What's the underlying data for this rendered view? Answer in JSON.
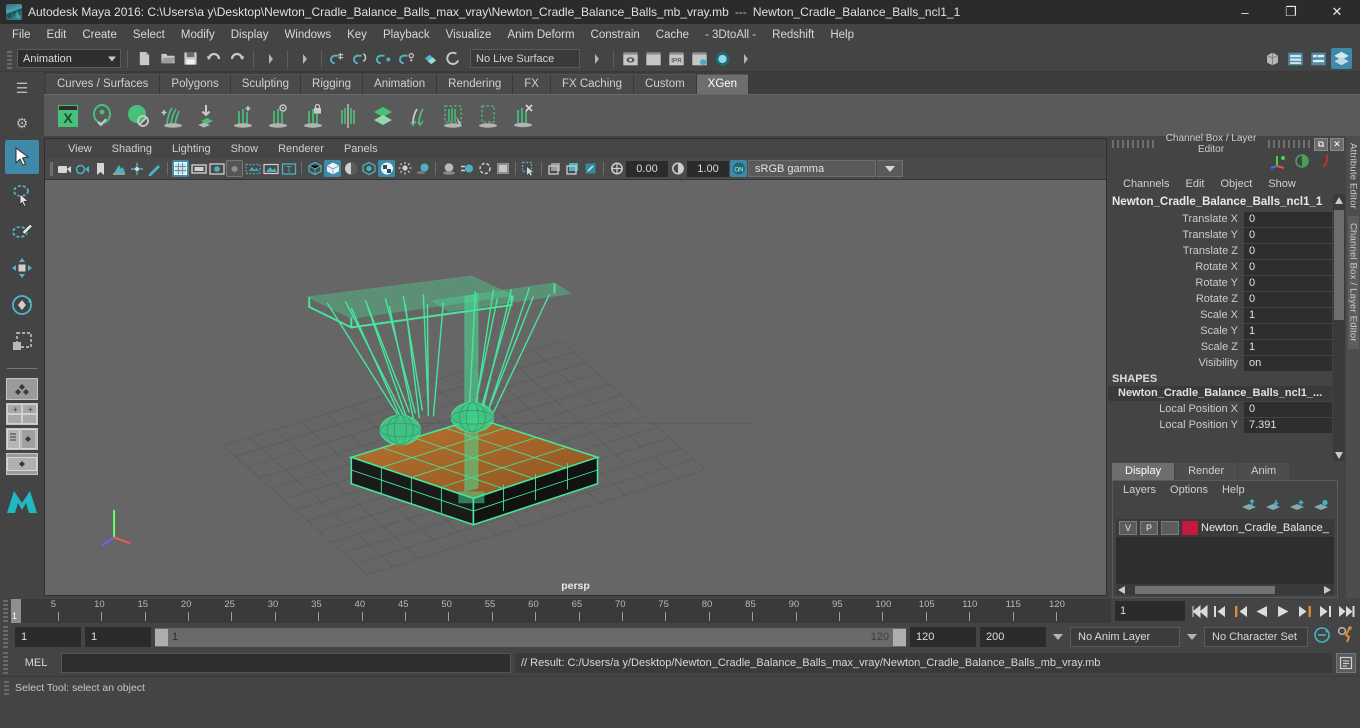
{
  "titlebar": {
    "app_title": "Autodesk Maya 2016: C:\\Users\\a y\\Desktop\\Newton_Cradle_Balance_Balls_max_vray\\Newton_Cradle_Balance_Balls_mb_vray.mb",
    "separator": "---",
    "selected_object": "Newton_Cradle_Balance_Balls_ncl1_1",
    "minimize": "–",
    "maximize": "❐",
    "close": "✕"
  },
  "menubar": {
    "items": [
      "File",
      "Edit",
      "Create",
      "Select",
      "Modify",
      "Display",
      "Windows",
      "Key",
      "Playback",
      "Visualize",
      "Anim Deform",
      "Constrain",
      "Cache",
      "- 3DtoAll -",
      "Redshift",
      "Help"
    ]
  },
  "statusline": {
    "mode": "Animation",
    "live_surface": "No Live Surface"
  },
  "shelf": {
    "tabs": [
      "Curves / Surfaces",
      "Polygons",
      "Sculpting",
      "Rigging",
      "Animation",
      "Rendering",
      "FX",
      "FX Caching",
      "Custom",
      "XGen"
    ],
    "active_tab": "XGen"
  },
  "viewport": {
    "menus": [
      "View",
      "Shading",
      "Lighting",
      "Show",
      "Renderer",
      "Panels"
    ],
    "exposure": "0.00",
    "gamma_value": "1.00",
    "color_toggle": "ON",
    "color_profile": "sRGB gamma",
    "camera_label": "persp",
    "background_color": "#666666",
    "wireframe_color": "#45e79a",
    "base_color": "#b5652f"
  },
  "channelbox": {
    "panel_title": "Channel Box / Layer Editor",
    "menus": [
      "Channels",
      "Edit",
      "Object",
      "Show"
    ],
    "object_name": "Newton_Cradle_Balance_Balls_ncl1_1",
    "transform_rows": [
      {
        "attr": "Translate X",
        "value": "0"
      },
      {
        "attr": "Translate Y",
        "value": "0"
      },
      {
        "attr": "Translate Z",
        "value": "0"
      },
      {
        "attr": "Rotate X",
        "value": "0"
      },
      {
        "attr": "Rotate Y",
        "value": "0"
      },
      {
        "attr": "Rotate Z",
        "value": "0"
      },
      {
        "attr": "Scale X",
        "value": "1"
      },
      {
        "attr": "Scale Y",
        "value": "1"
      },
      {
        "attr": "Scale Z",
        "value": "1"
      },
      {
        "attr": "Visibility",
        "value": "on"
      }
    ],
    "shapes_header": "SHAPES",
    "shape_name": "Newton_Cradle_Balance_Balls_ncl1_...",
    "shape_rows": [
      {
        "attr": "Local Position X",
        "value": "0"
      },
      {
        "attr": "Local Position Y",
        "value": "7.391"
      }
    ]
  },
  "layereditor": {
    "tabs": [
      "Display",
      "Render",
      "Anim"
    ],
    "active_tab": "Display",
    "menus": [
      "Layers",
      "Options",
      "Help"
    ],
    "layers": [
      {
        "visibility": "V",
        "playback": "P",
        "template": "",
        "color": "#c4183c",
        "name": "Newton_Cradle_Balance_"
      }
    ]
  },
  "right_tabs": [
    {
      "label": "Attribute Editor",
      "selected": false
    },
    {
      "label": "Channel Box / Layer Editor",
      "selected": true
    }
  ],
  "timeslider": {
    "ticks": [
      5,
      10,
      15,
      20,
      25,
      30,
      35,
      40,
      45,
      50,
      55,
      60,
      65,
      70,
      75,
      80,
      85,
      90,
      95,
      100,
      105,
      110,
      115,
      120
    ],
    "start": 1,
    "end": 120,
    "current_frame": "1",
    "cursor_label": "1",
    "playback_buttons": [
      "go-to-start",
      "step-back-key",
      "step-back-frame",
      "play-backwards",
      "play-forwards",
      "step-forward-frame",
      "step-forward-key",
      "go-to-end"
    ]
  },
  "rangeslider": {
    "anim_start": "1",
    "range_start": "1",
    "bar_start_label": "1",
    "bar_end_label": "120",
    "range_end": "120",
    "anim_end": "200",
    "anim_layer": "No Anim Layer",
    "character_set": "No Character Set"
  },
  "commandline": {
    "language": "MEL",
    "input_value": "",
    "result_text": "// Result: C:/Users/a y/Desktop/Newton_Cradle_Balance_Balls_max_vray/Newton_Cradle_Balance_Balls_mb_vray.mb"
  },
  "helpline": {
    "text": "Select Tool: select an object"
  }
}
